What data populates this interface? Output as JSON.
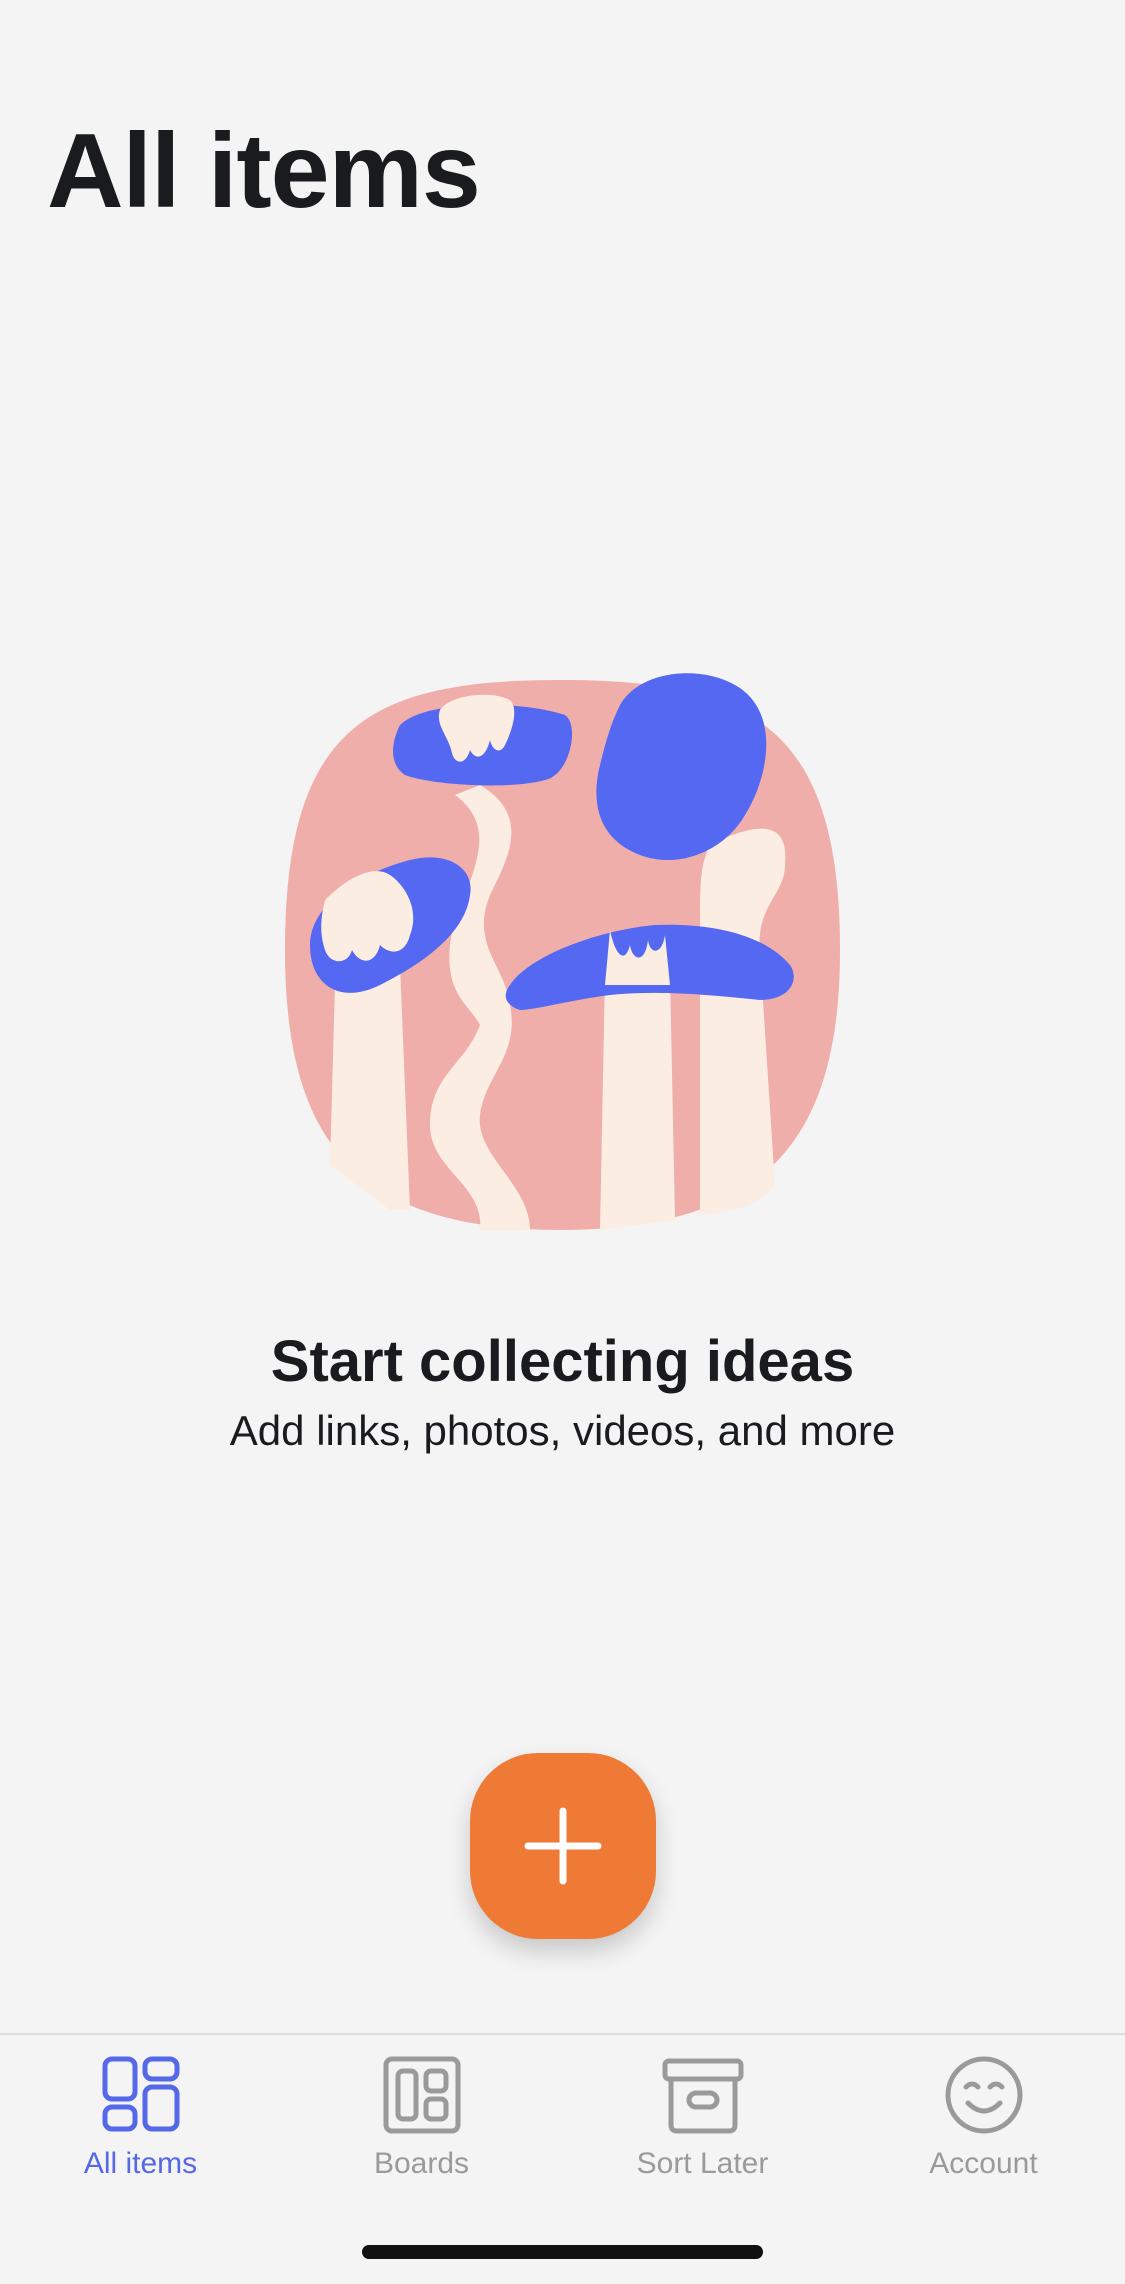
{
  "header": {
    "title": "All items"
  },
  "empty_state": {
    "illustration": "hands-holding-bread-illustration",
    "title": "Start collecting ideas",
    "subtitle": "Add links, photos, videos, and more"
  },
  "fab": {
    "icon": "plus-icon",
    "color": "#ef7a35"
  },
  "tab_bar": {
    "active_color": "#5468e8",
    "inactive_color": "#9a9a9a",
    "tabs": [
      {
        "label": "All items",
        "icon": "grid-icon",
        "active": true
      },
      {
        "label": "Boards",
        "icon": "boards-icon",
        "active": false
      },
      {
        "label": "Sort Later",
        "icon": "archive-box-icon",
        "active": false
      },
      {
        "label": "Account",
        "icon": "smiley-icon",
        "active": false
      }
    ]
  },
  "colors": {
    "background": "#f4f4f4",
    "illustration_pink": "#f0aeab",
    "illustration_blue": "#5468f2",
    "illustration_cream": "#fcede3"
  }
}
